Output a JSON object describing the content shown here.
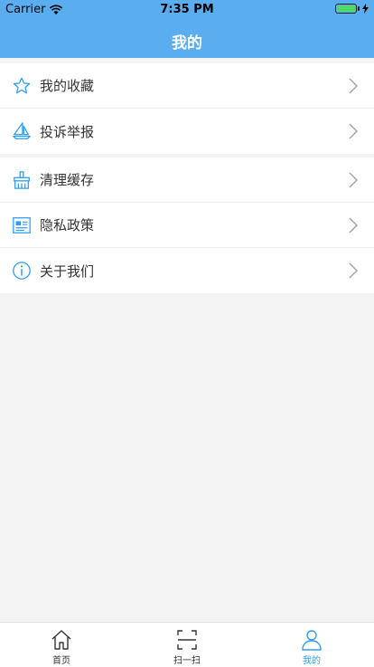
{
  "status_bar": {
    "carrier": "Carrier",
    "time": "7:35 PM"
  },
  "nav": {
    "title": "我的"
  },
  "menu_group_1": [
    {
      "label": "我的收藏",
      "icon": "star-icon"
    },
    {
      "label": "投诉举报",
      "icon": "sailboat-icon"
    }
  ],
  "menu_group_2": [
    {
      "label": "清理缓存",
      "icon": "broom-icon"
    },
    {
      "label": "隐私政策",
      "icon": "id-card-icon"
    },
    {
      "label": "关于我们",
      "icon": "info-icon"
    }
  ],
  "tabbar": {
    "items": [
      {
        "label": "首页",
        "icon": "home-icon",
        "active": false
      },
      {
        "label": "扫一扫",
        "icon": "scan-icon",
        "active": false
      },
      {
        "label": "我的",
        "icon": "person-icon",
        "active": true
      }
    ]
  },
  "colors": {
    "accent": "#2f9df4",
    "header": "#5aaef0"
  }
}
